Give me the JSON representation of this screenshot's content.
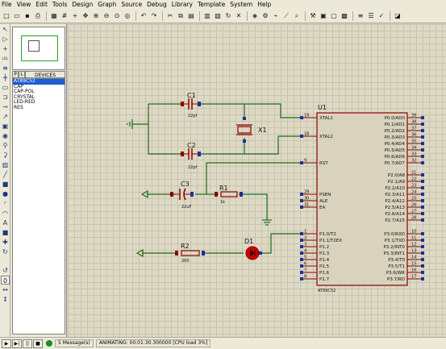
{
  "menu": [
    "File",
    "View",
    "Edit",
    "Tools",
    "Design",
    "Graph",
    "Source",
    "Debug",
    "Library",
    "Template",
    "System",
    "Help"
  ],
  "toolbar_icons": [
    "new-icon",
    "open-icon",
    "save-icon",
    "print-icon",
    "sep",
    "area-icon",
    "grid-icon",
    "origin-icon",
    "pan-icon",
    "zoom-in-icon",
    "zoom-out-icon",
    "zoom-all-icon",
    "zoom-area-icon",
    "sep",
    "undo-icon",
    "redo-icon",
    "sep",
    "cut-icon",
    "copy-icon",
    "paste-icon",
    "sep",
    "block-copy-icon",
    "block-move-icon",
    "block-rotate-icon",
    "block-delete-icon",
    "sep",
    "pick-device-icon",
    "make-device-icon",
    "decompose-icon",
    "wire-autorouter-icon",
    "search-icon",
    "sep",
    "property-tool-icon",
    "design-explorer-icon",
    "new-sheet-icon",
    "remove-sheet-icon",
    "sep",
    "netlist-icon",
    "bom-icon",
    "electrical-check-icon",
    "sep",
    "ares-icon"
  ],
  "left_tools": [
    "select-icon",
    "component-icon",
    "junction-icon",
    "wire-label-icon",
    "text-script-icon",
    "bus-icon",
    "subcircuit-icon",
    "terminal-icon",
    "device-pin-icon",
    "graph-icon",
    "tape-icon",
    "generator-icon",
    "voltage-probe-icon",
    "current-probe-icon",
    "virtual-instrument-icon",
    "line-icon",
    "box-icon",
    "circle-icon",
    "arc-icon",
    "path-icon",
    "text-icon",
    "symbol-icon",
    "marker-icon",
    "rotate-cw-icon",
    "rotate-ccw-icon",
    "angle-field",
    "mirror-x-icon",
    "mirror-y-icon"
  ],
  "left_tools_angle": "0",
  "devices": {
    "picker_p": "P",
    "picker_l": "L",
    "title": "DEVICES",
    "items": [
      "AT89C52",
      "CAP",
      "CAP-POL",
      "CRYSTAL",
      "LED-RED",
      "RES"
    ],
    "selected_index": 0
  },
  "schematic": {
    "c1": {
      "ref": "C1",
      "value": "22pf"
    },
    "c2": {
      "ref": "C2",
      "value": "22pf"
    },
    "c3": {
      "ref": "C3",
      "value": "22uF"
    },
    "x1": {
      "ref": "X1"
    },
    "r1": {
      "ref": "R1",
      "value": "1k"
    },
    "r2": {
      "ref": "R2",
      "value": "200"
    },
    "d1": {
      "ref": "D1"
    },
    "u1": {
      "ref": "U1",
      "part": "AT89C52",
      "left_pins": [
        {
          "num": "19",
          "name": "XTAL1"
        },
        {
          "num": "18",
          "name": "XTAL2"
        },
        {
          "num": "9",
          "name": "RST"
        },
        {
          "num": "29",
          "name": "PSEN"
        },
        {
          "num": "30",
          "name": "ALE"
        },
        {
          "num": "31",
          "name": "EA"
        },
        {
          "num": "1",
          "name": "P1.0/T2"
        },
        {
          "num": "2",
          "name": "P1.1/T2EX"
        },
        {
          "num": "3",
          "name": "P1.2"
        },
        {
          "num": "4",
          "name": "P1.3"
        },
        {
          "num": "5",
          "name": "P1.4"
        },
        {
          "num": "6",
          "name": "P1.5"
        },
        {
          "num": "7",
          "name": "P1.6"
        },
        {
          "num": "8",
          "name": "P1.7"
        }
      ],
      "right_pins": [
        {
          "num": "39",
          "name": "P0.0/AD0"
        },
        {
          "num": "38",
          "name": "P0.1/AD1"
        },
        {
          "num": "37",
          "name": "P0.2/AD2"
        },
        {
          "num": "36",
          "name": "P0.3/AD3"
        },
        {
          "num": "35",
          "name": "P0.4/AD4"
        },
        {
          "num": "34",
          "name": "P0.5/AD5"
        },
        {
          "num": "33",
          "name": "P0.6/AD6"
        },
        {
          "num": "32",
          "name": "P0.7/AD7"
        },
        {
          "num": "21",
          "name": "P2.0/A8"
        },
        {
          "num": "22",
          "name": "P2.1/A9"
        },
        {
          "num": "23",
          "name": "P2.2/A10"
        },
        {
          "num": "24",
          "name": "P2.3/A11"
        },
        {
          "num": "25",
          "name": "P2.4/A12"
        },
        {
          "num": "26",
          "name": "P2.5/A13"
        },
        {
          "num": "27",
          "name": "P2.6/A14"
        },
        {
          "num": "28",
          "name": "P2.7/A15"
        },
        {
          "num": "10",
          "name": "P3.0/RXD"
        },
        {
          "num": "11",
          "name": "P3.1/TXD"
        },
        {
          "num": "12",
          "name": "P3.2/INT0"
        },
        {
          "num": "13",
          "name": "P3.3/INT1"
        },
        {
          "num": "14",
          "name": "P3.4/T0"
        },
        {
          "num": "15",
          "name": "P3.5/T1"
        },
        {
          "num": "16",
          "name": "P3.6/WR"
        },
        {
          "num": "17",
          "name": "P3.7/RD"
        }
      ]
    }
  },
  "status": {
    "play": "▶",
    "step": "▶|",
    "pause": "||",
    "stop": "■",
    "messages": "5 Message(s)",
    "animating": "ANIMATING: 00:01:30.300000 [CPU load 3%]"
  },
  "colors": {
    "wire": "#1e6b1e",
    "component": "#8b0000",
    "pin": "#1f2f9a",
    "canvas": "#ddd9c5",
    "grid": "#c9c4ad",
    "led": "#cc0000"
  }
}
